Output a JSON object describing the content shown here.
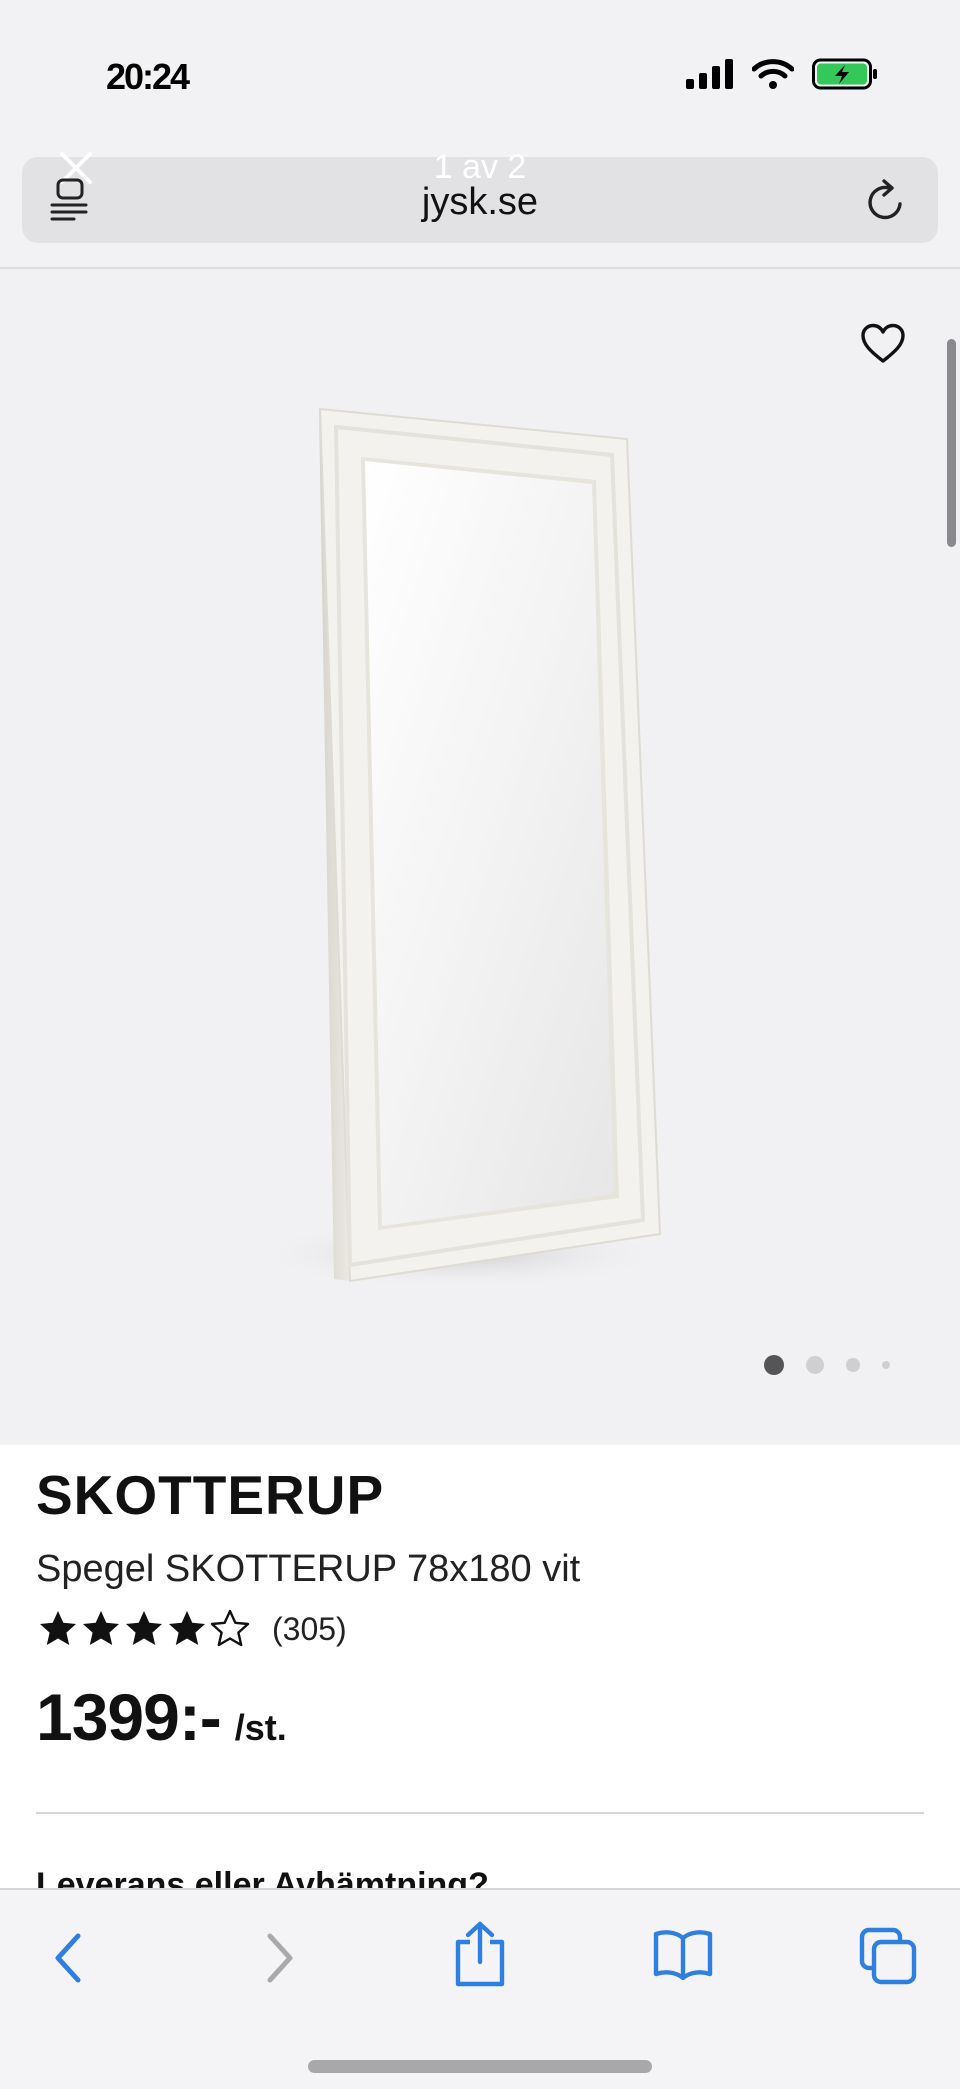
{
  "status_bar": {
    "time": "20:24"
  },
  "browser": {
    "tab_count_label": "1 av 2",
    "url": "jysk.se"
  },
  "gallery": {
    "image_description": "mirror-product-image",
    "pages": 4,
    "active_page": 1
  },
  "product": {
    "brand_title": "SKOTTERUP",
    "name": "Spegel SKOTTERUP 78x180 vit",
    "rating": {
      "stars": 4,
      "max": 5,
      "count_label": "(305)"
    },
    "price": {
      "amount": "1399:-",
      "unit": "/st."
    }
  },
  "delivery_section": {
    "heading": "Leverans eller Avhämtning?"
  },
  "toolbar": {
    "buttons": [
      "back-icon",
      "forward-icon",
      "share-icon",
      "bookmarks-icon",
      "tabs-icon"
    ],
    "accent_color": "#2f7fe0",
    "disabled_color": "#a9a9ad"
  },
  "colors": {
    "gallery_bg": "#f1f0f2",
    "chrome_bg": "#f2f2f4",
    "battery_green": "#34c759"
  }
}
